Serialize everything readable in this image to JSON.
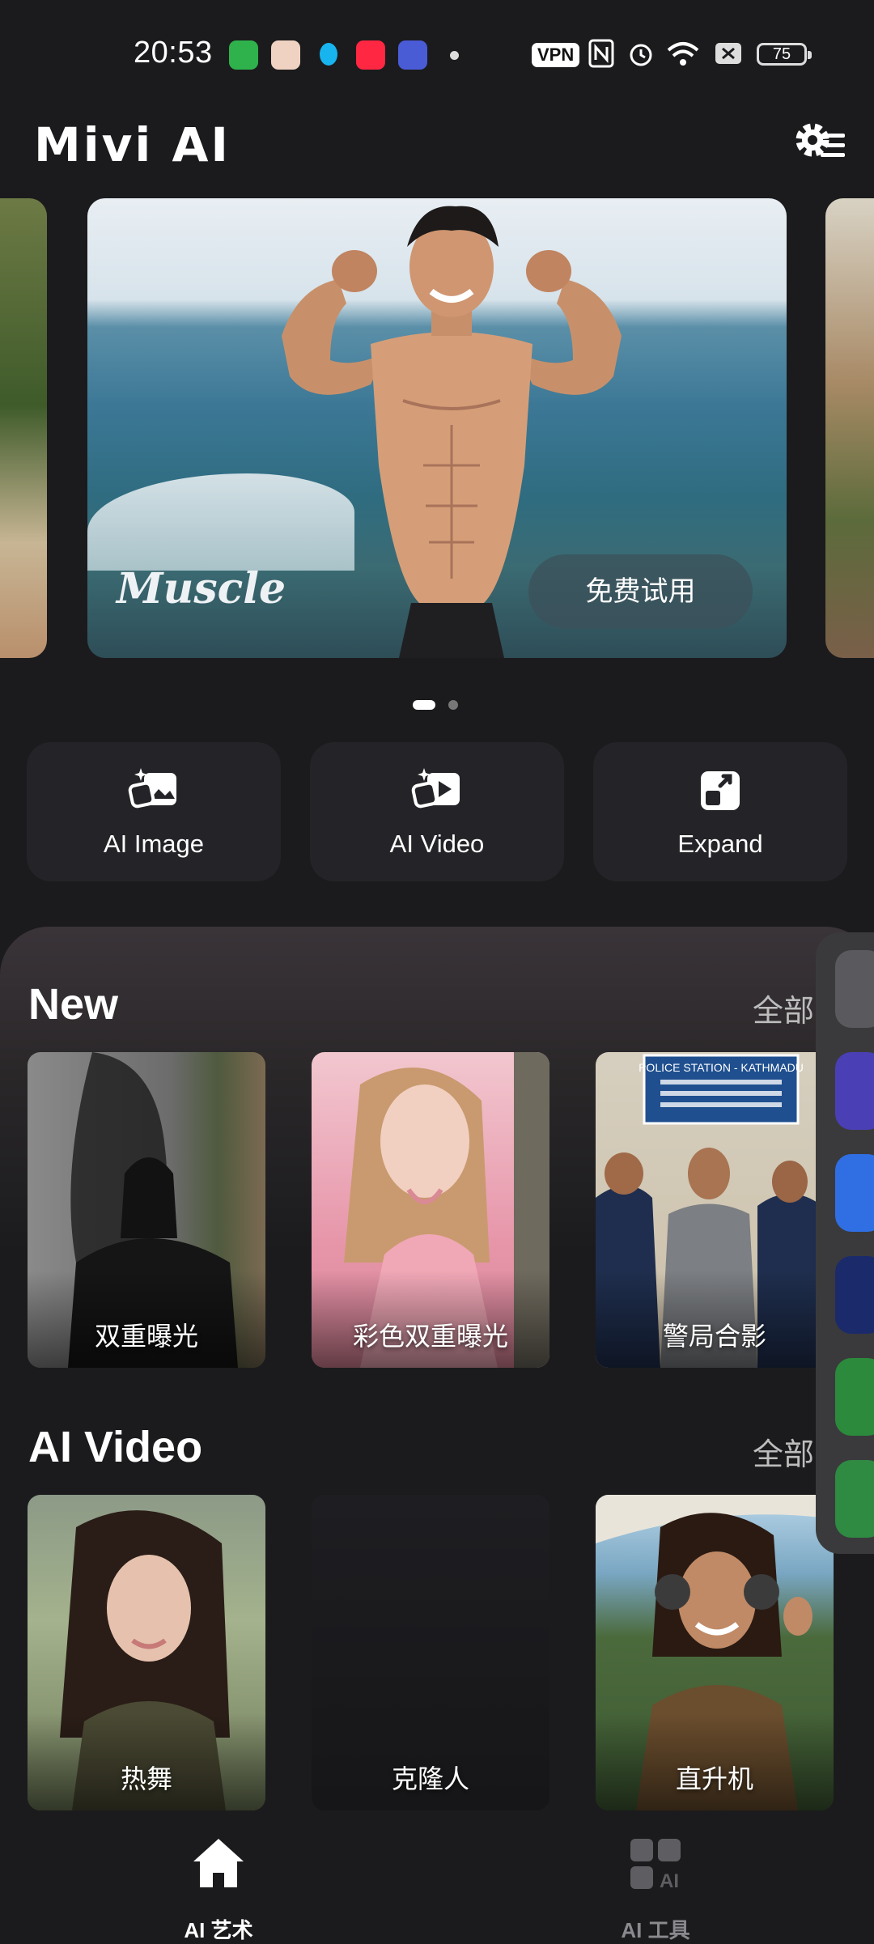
{
  "status_bar": {
    "time": "20:53",
    "vpn": "VPN",
    "battery": "75"
  },
  "header": {
    "title": "Mivi AI"
  },
  "banner": {
    "brand_text": "Muscle",
    "try_button": "免费试用"
  },
  "tools": [
    {
      "label": "AI Image",
      "icon": "ai-image-icon"
    },
    {
      "label": "AI Video",
      "icon": "ai-video-icon"
    },
    {
      "label": "Expand",
      "icon": "expand-icon"
    }
  ],
  "sections": {
    "new": {
      "title": "New",
      "all_label": "全部 >",
      "cards": [
        "双重曝光",
        "彩色双重曝光",
        "警局合影"
      ]
    },
    "ai_video": {
      "title": "AI Video",
      "all_label": "全部 >",
      "cards": [
        "热舞",
        "克隆人",
        "直升机"
      ]
    }
  },
  "police_sign": {
    "line1": "POLICE STATION - KATHMADU"
  },
  "bottom_nav": [
    {
      "label": "AI 艺术",
      "icon": "home-icon",
      "active": true
    },
    {
      "label": "AI 工具",
      "icon": "ai-tools-icon",
      "active": false
    }
  ],
  "colors": {
    "background": "#1b1b1d",
    "card": "#242428",
    "accent_white": "#ffffff"
  }
}
